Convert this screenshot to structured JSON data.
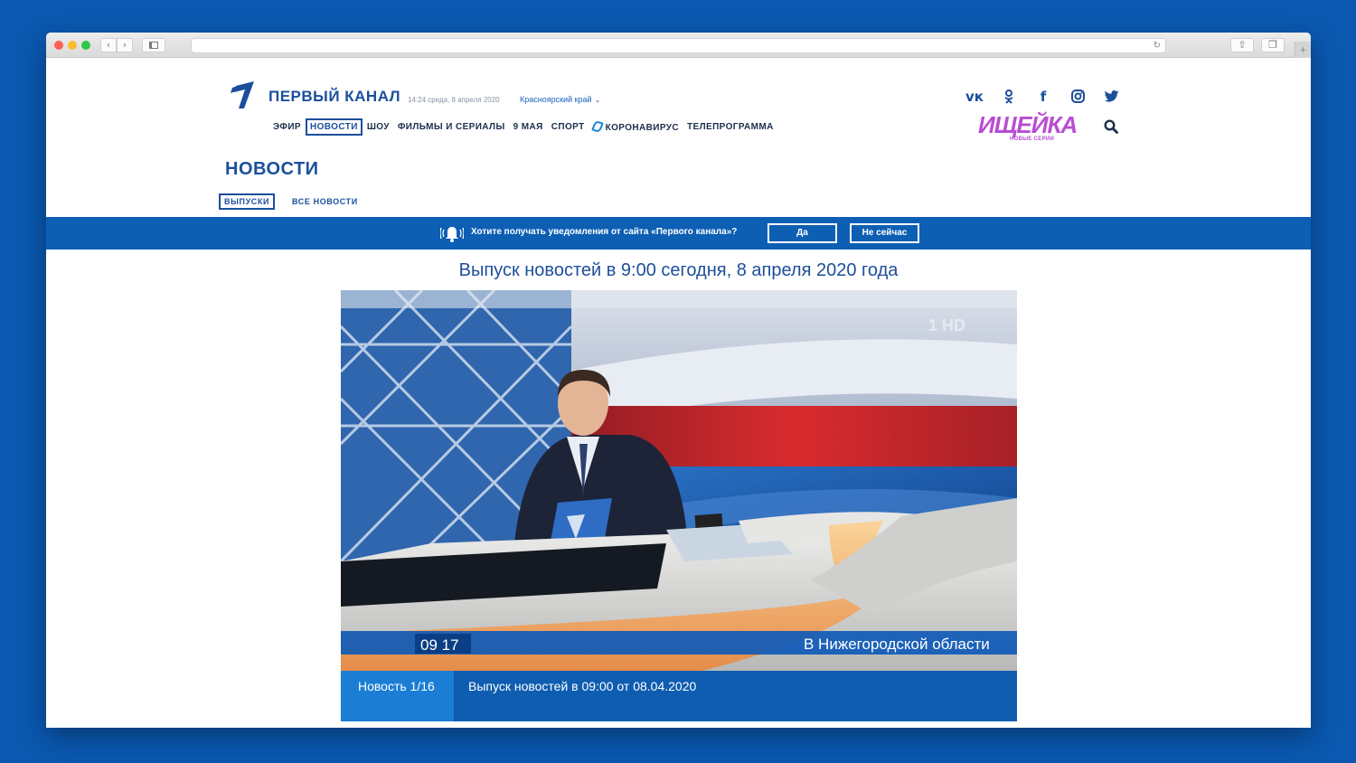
{
  "header": {
    "brand": "ПЕРВЫЙ КАНАЛ",
    "datetime": "14:24 среда, 8 апреля 2020",
    "region": "Красноярский край"
  },
  "nav": {
    "items": [
      "ЭФИР",
      "НОВОСТИ",
      "ШОУ",
      "ФИЛЬМЫ И СЕРИАЛЫ",
      "9 МАЯ",
      "СПОРТ",
      "КОРОНАВИРУС",
      "ТЕЛЕПРОГРАММА"
    ],
    "active": "НОВОСТИ"
  },
  "social": [
    "vk-icon",
    "odnoklassniki-icon",
    "facebook-icon",
    "instagram-icon",
    "twitter-icon"
  ],
  "promo": {
    "title": "ИЩЕЙКА",
    "subtitle": "НОВЫЕ СЕРИИ"
  },
  "section": {
    "title": "НОВОСТИ",
    "tabs": [
      "ВЫПУСКИ",
      "ВСЕ НОВОСТИ"
    ]
  },
  "notification": {
    "text": "Хотите получать уведомления от сайта «Первого канала»?",
    "yes": "Да",
    "no": "Не сейчас"
  },
  "episode": {
    "title": "Выпуск новостей в 9:00 сегодня,  8 апреля 2020 года"
  },
  "video": {
    "time": "09 17",
    "ticker": "В Нижегородской области",
    "watermark": "1 HD"
  },
  "caption": {
    "counter": "Новость 1/16",
    "text": "Выпуск новостей в 09:00 от 08.04.2020"
  },
  "colors": {
    "page_bg": "#0a58b0",
    "brand_blue": "#1b4f9c",
    "notif_bar": "#0d5fb4",
    "promo": "#b94cd3"
  }
}
